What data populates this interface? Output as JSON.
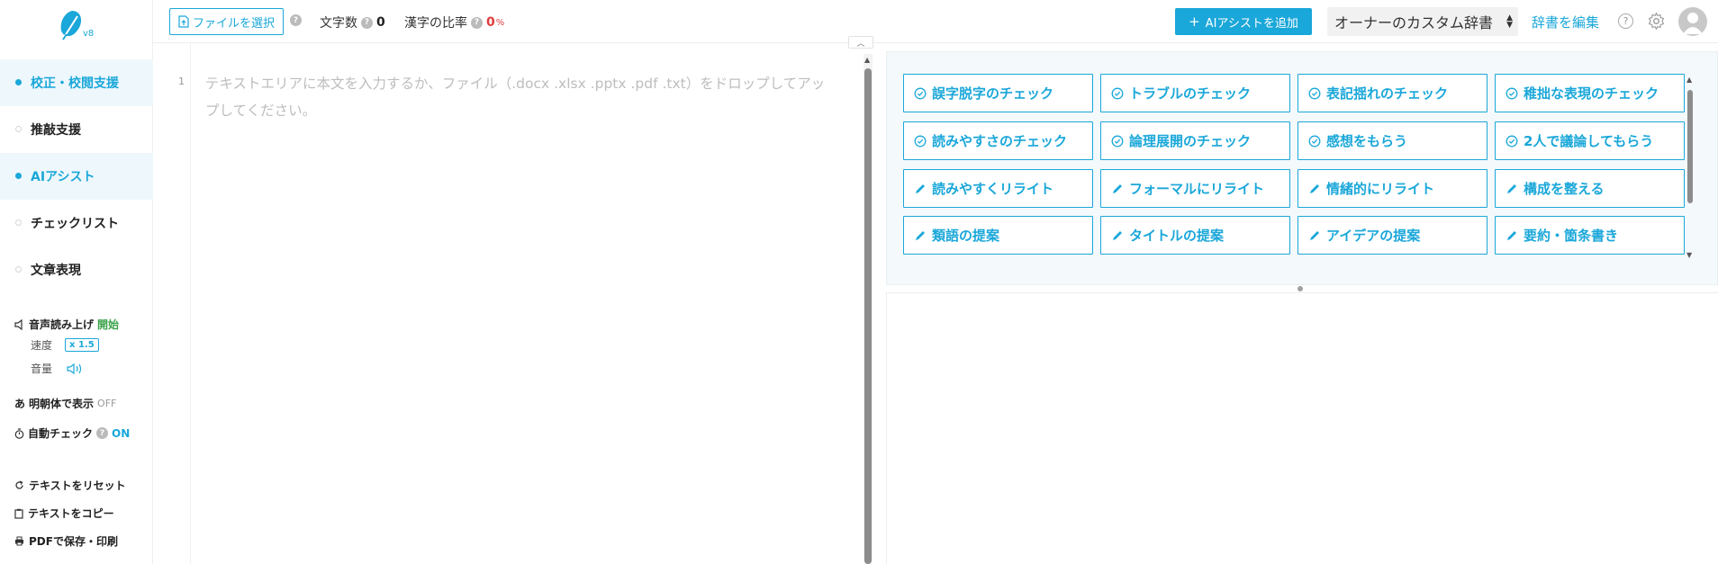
{
  "logo": {
    "version": "v8"
  },
  "sidebar": {
    "items": [
      {
        "label": "校正・校閲支援",
        "active": true
      },
      {
        "label": "推敲支援",
        "active": false
      },
      {
        "label": "AIアシスト",
        "active": true
      },
      {
        "label": "チェックリスト",
        "active": false
      },
      {
        "label": "文章表現",
        "active": false
      }
    ],
    "voice": {
      "label": "音声読み上げ",
      "start": "開始",
      "speed_label": "速度",
      "speed_value": "x 1.5",
      "volume_label": "音量"
    },
    "mincho": {
      "label": "明朝体で表示",
      "state": "OFF"
    },
    "autocheck": {
      "label": "自動チェック",
      "state": "ON"
    },
    "actions": {
      "reset": "テキストをリセット",
      "copy": "テキストをコピー",
      "pdf": "PDFで保存・印刷"
    }
  },
  "header": {
    "file_button": "ファイルを選択",
    "char_count_label": "文字数",
    "char_count_value": "0",
    "kanji_ratio_label": "漢字の比率",
    "kanji_ratio_value": "0",
    "kanji_ratio_unit": "%",
    "ai_add_button": "AIアシストを追加",
    "dict_select": "オーナーのカスタム辞書",
    "dict_edit": "辞書を編集"
  },
  "editor": {
    "line_number": "1",
    "placeholder": "テキストエリアに本文を入力するか、ファイル（.docx .xlsx .pptx .pdf .txt）をドロップしてアップしてください。"
  },
  "ai_buttons": [
    {
      "label": "誤字脱字のチェック",
      "icon": "check-circle-icon"
    },
    {
      "label": "トラブルのチェック",
      "icon": "check-circle-icon"
    },
    {
      "label": "表記揺れのチェック",
      "icon": "check-circle-icon"
    },
    {
      "label": "稚拙な表現のチェック",
      "icon": "check-circle-icon"
    },
    {
      "label": "読みやすさのチェック",
      "icon": "check-circle-icon"
    },
    {
      "label": "論理展開のチェック",
      "icon": "check-circle-icon"
    },
    {
      "label": "感想をもらう",
      "icon": "check-circle-icon"
    },
    {
      "label": "2人で議論してもらう",
      "icon": "check-circle-icon"
    },
    {
      "label": "読みやすくリライト",
      "icon": "pencil-icon"
    },
    {
      "label": "フォーマルにリライト",
      "icon": "pencil-icon"
    },
    {
      "label": "情緒的にリライト",
      "icon": "pencil-icon"
    },
    {
      "label": "構成を整える",
      "icon": "pencil-icon"
    },
    {
      "label": "類語の提案",
      "icon": "pencil-icon"
    },
    {
      "label": "タイトルの提案",
      "icon": "pencil-icon"
    },
    {
      "label": "アイデアの提案",
      "icon": "pencil-icon"
    },
    {
      "label": "要約・箇条書き",
      "icon": "pencil-icon"
    }
  ],
  "colors": {
    "accent": "#1aa7d9",
    "danger": "#e03c3c",
    "success": "#3aa34a"
  }
}
